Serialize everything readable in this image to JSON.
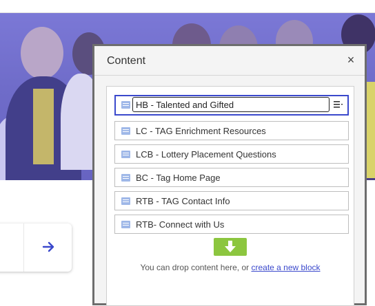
{
  "dialog": {
    "title": "Content",
    "close_symbol": "×",
    "blocks": [
      {
        "label": "HB - Talented and Gifted",
        "selected": true
      },
      {
        "label": "LC - TAG Enrichment Resources"
      },
      {
        "label": "LCB - Lottery Placement Questions"
      },
      {
        "label": "BC - Tag Home Page"
      },
      {
        "label": "RTB - TAG Contact Info"
      },
      {
        "label": "RTB- Connect with Us"
      }
    ],
    "drop_hint": "You can drop content here, or",
    "create_link": "create a new block"
  },
  "icons": {
    "block_icon": "document-lines-icon",
    "menu_icon": "hamburger-menu-icon",
    "drop_icon": "download-arrow-icon",
    "nav_icon": "arrow-right-icon"
  },
  "colors": {
    "hero_overlay": "#6f6cc9",
    "selection_border": "#3a48cc",
    "drop_button": "#8cc63f",
    "link": "#3a48cc",
    "nav_arrow": "#3a48cc"
  }
}
